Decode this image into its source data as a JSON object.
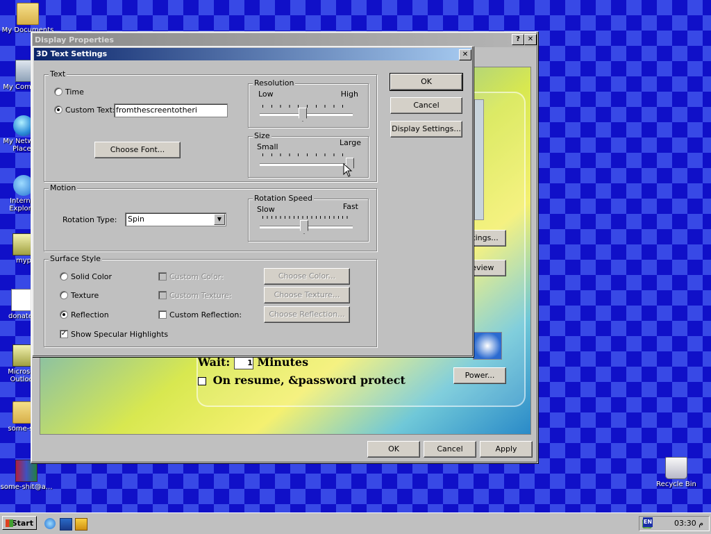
{
  "desktop": {
    "icons": [
      {
        "label": "My Documents"
      },
      {
        "label": "My Computer"
      },
      {
        "label": "My Network Places"
      },
      {
        "label": "Internet Explorer"
      },
      {
        "label": "myp"
      },
      {
        "label": "donate_"
      },
      {
        "label": "Microsoft Outlook"
      },
      {
        "label": "some-shi"
      },
      {
        "label": "some-shit@a..."
      },
      {
        "label": "Recycle Bin"
      }
    ]
  },
  "display_properties": {
    "title": "Display Properties",
    "help_btn": "?",
    "close_btn": "✕",
    "settings_btn": "Settings...",
    "preview_btn": "Preview",
    "wait_label": "Wait:",
    "wait_value": "1",
    "minutes_label": "Minutes",
    "resume_label": "On resume, &password protect",
    "power_btn": "Power...",
    "ok_btn": "OK",
    "cancel_btn": "Cancel",
    "apply_btn": "Apply"
  },
  "dialog": {
    "title": "3D Text Settings",
    "close_btn": "✕",
    "ok_btn": "OK",
    "cancel_btn": "Cancel",
    "display_settings_btn": "Display Settings...",
    "text_group": {
      "label": "Text",
      "time_label": "Time",
      "custom_text_label": "Custom Text:",
      "custom_text_value": "fromthescreentotheri",
      "selected": "Custom Text",
      "choose_font_btn": "Choose Font..."
    },
    "resolution": {
      "label": "Resolution",
      "low": "Low",
      "high": "High",
      "value_fraction": 0.45
    },
    "size": {
      "label": "Size",
      "small": "Small",
      "large": "Large",
      "value_fraction": 1.0
    },
    "motion_group": {
      "label": "Motion",
      "rotation_type_label": "Rotation Type:",
      "rotation_type_value": "Spin"
    },
    "rotation_speed": {
      "label": "Rotation Speed",
      "slow": "Slow",
      "fast": "Fast",
      "value_fraction": 0.46
    },
    "surface_group": {
      "label": "Surface Style",
      "solid_color": "Solid Color",
      "texture": "Texture",
      "reflection": "Reflection",
      "selected": "Reflection",
      "show_specular": "Show Specular Highlights",
      "show_specular_checked": true,
      "custom_color": "Custom Color:",
      "custom_texture": "Custom Texture:",
      "custom_reflection": "Custom Reflection:",
      "choose_color_btn": "Choose Color...",
      "choose_texture_btn": "Choose Texture...",
      "choose_reflection_btn": "Choose Reflection..."
    }
  },
  "taskbar": {
    "start_label": "Start",
    "language": "EN",
    "clock": "03:30 م"
  }
}
